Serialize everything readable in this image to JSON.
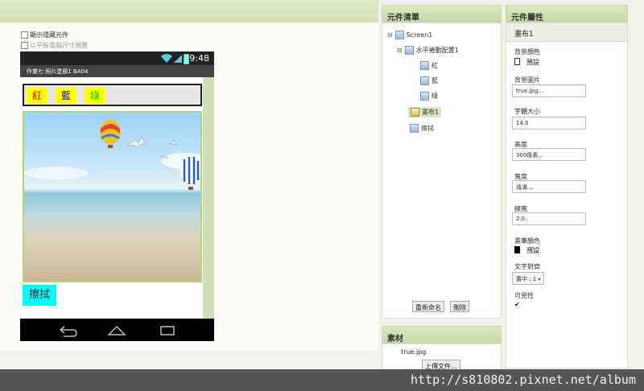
{
  "viewer": {
    "show_hidden_label": "顯示隱藏元件",
    "tablet_preview_label": "以平板電腦尺寸預覽",
    "status_time": "9:48",
    "screen_title": "作業七 照片塗鴉1 BA04",
    "buttons": [
      {
        "label": "紅",
        "bg": "#ffff00",
        "color": "#ff0000"
      },
      {
        "label": "藍",
        "bg": "#ffff00",
        "color": "#0000cc"
      },
      {
        "label": "綠",
        "bg": "#ffff00",
        "color": "#00cc00"
      }
    ],
    "erase_label": "擦拭",
    "erase_bg": "#00ffff"
  },
  "components": {
    "title": "元件清單",
    "tree": [
      {
        "label": "Screen1",
        "toggle": "⊟"
      },
      {
        "label": "水平捲動配置1",
        "toggle": "⊟"
      },
      {
        "label": "紅"
      },
      {
        "label": "藍"
      },
      {
        "label": "綠"
      },
      {
        "label": "畫布1"
      },
      {
        "label": "擦拭"
      }
    ],
    "rename_label": "重新命名",
    "delete_label": "刪除"
  },
  "media": {
    "title": "素材",
    "file": "true.jpg",
    "upload_label": "上傳文件..."
  },
  "properties": {
    "title": "元件屬性",
    "component_name": "畫布1",
    "bg_color_label": "背景顏色",
    "bg_color_value": "預設",
    "bg_image_label": "背景圖片",
    "bg_image_value": "true.jpg...",
    "font_size_label": "字體大小",
    "font_size_value": "14.0",
    "height_label": "高度",
    "height_value": "300像素...",
    "width_label": "寬度",
    "width_value": "填滿...",
    "line_width_label": "線寬",
    "line_width_value": "2.0",
    "paint_color_label": "畫筆顏色",
    "paint_color_value": "預設",
    "text_align_label": "文字對齊",
    "text_align_value": "置中 : 1",
    "visible_label": "可見性",
    "visible_check": "✔"
  },
  "watermark": "http://s810802.pixnet.net/album"
}
